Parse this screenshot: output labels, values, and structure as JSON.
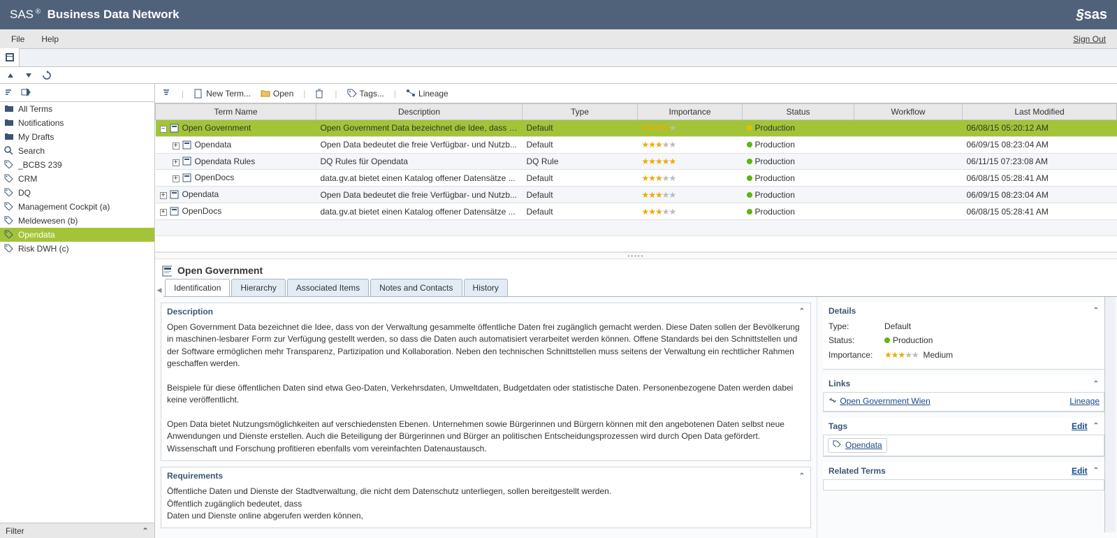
{
  "app": {
    "title_prefix": "SAS",
    "title": "Business Data Network",
    "logo": "SAS"
  },
  "menu": {
    "file": "File",
    "help": "Help",
    "signout": "Sign Out"
  },
  "sidebar": {
    "items": [
      {
        "label": "All Terms",
        "icon": "folder"
      },
      {
        "label": "Notifications",
        "icon": "folder"
      },
      {
        "label": "My Drafts",
        "icon": "folder"
      },
      {
        "label": "Search",
        "icon": "search"
      },
      {
        "label": "_BCBS 239",
        "icon": "tag"
      },
      {
        "label": "CRM",
        "icon": "tag"
      },
      {
        "label": "DQ",
        "icon": "tag"
      },
      {
        "label": "Management Cockpit (a)",
        "icon": "tag"
      },
      {
        "label": "Meldewesen (b)",
        "icon": "tag"
      },
      {
        "label": "Opendata",
        "icon": "tag",
        "selected": true
      },
      {
        "label": "Risk DWH (c)",
        "icon": "tag"
      }
    ],
    "filter": "Filter"
  },
  "toolbar": {
    "new_term": "New Term...",
    "open": "Open",
    "tags": "Tags...",
    "lineage": "Lineage"
  },
  "grid": {
    "cols": [
      "Term Name",
      "Description",
      "Type",
      "Importance",
      "Status",
      "Workflow",
      "Last Modified"
    ],
    "rows": [
      {
        "indent": 0,
        "exp": "−",
        "name": "Open Government",
        "desc": "Open Government Data bezeichnet die Idee, dass v...",
        "type": "Default",
        "stars": 3.5,
        "stars5": false,
        "status": "Production",
        "dot": "y",
        "wf": "",
        "mod": "06/08/15 05:20:12 AM",
        "hl": true
      },
      {
        "indent": 1,
        "exp": "+",
        "name": "Opendata",
        "desc": "Open Data bedeutet die freie Verfügbar- und Nutzb...",
        "type": "Default",
        "stars": 3,
        "status": "Production",
        "dot": "g",
        "wf": "",
        "mod": "06/09/15 08:23:04 AM"
      },
      {
        "indent": 1,
        "exp": "+",
        "name": "Opendata Rules",
        "desc": "DQ Rules für Opendata",
        "type": "DQ Rule",
        "stars": 5,
        "stars5": true,
        "status": "Production",
        "dot": "g",
        "wf": "",
        "mod": "06/11/15 07:23:08 AM"
      },
      {
        "indent": 1,
        "exp": "+",
        "name": "OpenDocs",
        "desc": "data.gv.at bietet einen Katalog offener Datensätze ...",
        "type": "Default",
        "stars": 3,
        "status": "Production",
        "dot": "g",
        "wf": "",
        "mod": "06/08/15 05:28:41 AM"
      },
      {
        "indent": 0,
        "exp": "+",
        "name": "Opendata",
        "desc": "Open Data bedeutet die freie Verfügbar- und Nutzb...",
        "type": "Default",
        "stars": 3,
        "status": "Production",
        "dot": "g",
        "wf": "",
        "mod": "06/09/15 08:23:04 AM"
      },
      {
        "indent": 0,
        "exp": "+",
        "name": "OpenDocs",
        "desc": "data.gv.at bietet einen Katalog offener Datensätze ...",
        "type": "Default",
        "stars": 3,
        "status": "Production",
        "dot": "g",
        "wf": "",
        "mod": "06/08/15 05:28:41 AM"
      }
    ]
  },
  "detail": {
    "title": "Open Government",
    "tabs": [
      "Identification",
      "Hierarchy",
      "Associated Items",
      "Notes and Contacts",
      "History"
    ],
    "active_tab": 0,
    "description_head": "Description",
    "description": "Open Government Data bezeichnet die Idee, dass von der Verwaltung gesammelte öffentliche Daten frei zugänglich gemacht werden. Diese Daten sollen der Bevölkerung in maschinen-lesbarer Form zur Verfügung gestellt werden, so dass die Daten auch automatisiert verarbeitet werden können. Offene Standards bei den Schnittstellen und der Software ermöglichen mehr Transparenz, Partizipation und Kollaboration. Neben den technischen Schnittstellen muss seitens der Verwaltung ein rechtlicher Rahmen geschaffen werden.\n\nBeispiele für diese öffentlichen Daten sind etwa Geo-Daten, Verkehrsdaten, Umweltdaten, Budgetdaten oder statistische Daten. Personenbezogene Daten werden dabei keine veröffentlicht.\n\nOpen Data bietet Nutzungsmöglichkeiten auf verschiedensten Ebenen. Unternehmen sowie Bürgerinnen und Bürgern können mit den angebotenen Daten selbst neue Anwendungen und Dienste erstellen. Auch die Beteiligung der Bürgerinnen und Bürger an politischen Entscheidungsprozessen wird durch Open Data gefördert. Wissenschaft und Forschung profitieren ebenfalls vom vereinfachten Datenaustausch.",
    "requirements_head": "Requirements",
    "requirements": "Öffentliche Daten und Dienste der Stadtverwaltung, die nicht dem Datenschutz unterliegen, sollen bereitgestellt werden.\nÖffentlich zugänglich bedeutet, dass\nDaten und Dienste online abgerufen werden können,",
    "details_head": "Details",
    "type_label": "Type:",
    "type_value": "Default",
    "status_label": "Status:",
    "status_value": "Production",
    "importance_label": "Importance:",
    "importance_value": "Medium",
    "links_head": "Links",
    "link_name": "Open Government Wien",
    "lineage": "Lineage",
    "tags_head": "Tags",
    "edit": "Edit",
    "tag_name": "Opendata",
    "related_head": "Related Terms"
  }
}
